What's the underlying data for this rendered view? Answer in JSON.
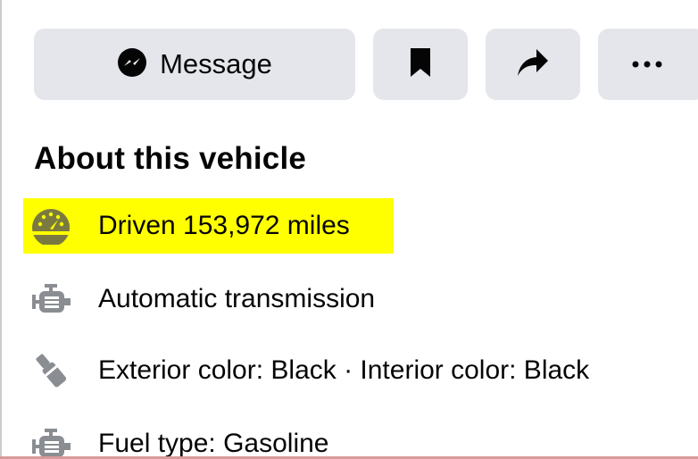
{
  "actions": {
    "message_label": "Message",
    "message_icon": "messenger-icon",
    "save_icon": "bookmark-icon",
    "share_icon": "share-arrow-icon",
    "more_icon": "more-dots-icon"
  },
  "about": {
    "heading": "About this vehicle",
    "items": [
      {
        "icon": "speedometer-icon",
        "text": "Driven 153,972 miles",
        "highlighted": true
      },
      {
        "icon": "engine-icon",
        "text": "Automatic transmission"
      },
      {
        "icon": "paint-brush-icon",
        "text": "Exterior color: Black · Interior color: Black"
      },
      {
        "icon": "engine-icon",
        "text": "Fuel type: Gasoline"
      }
    ]
  },
  "colors": {
    "button_bg": "#e4e6eb",
    "icon_gray": "#8a8d91",
    "highlight": "#ffff00",
    "text": "#050505"
  }
}
